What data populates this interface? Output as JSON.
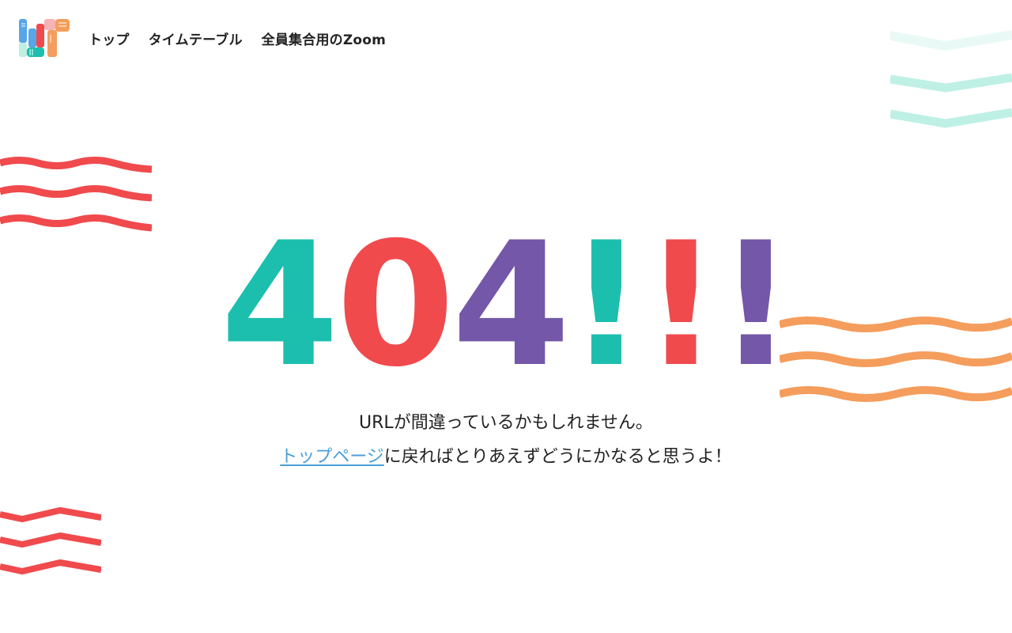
{
  "nav": {
    "items": [
      {
        "label": "トップ"
      },
      {
        "label": "タイムテーブル"
      },
      {
        "label": "全員集合用のZoom"
      }
    ]
  },
  "hero": {
    "chars": [
      {
        "text": "4",
        "color": "#1cbfad"
      },
      {
        "text": "0",
        "color": "#f04a4d"
      },
      {
        "text": "4",
        "color": "#7457a8"
      },
      {
        "text": "!",
        "color": "#1cbfad"
      },
      {
        "text": "!",
        "color": "#f04a4d"
      },
      {
        "text": "!",
        "color": "#7457a8"
      }
    ]
  },
  "message": {
    "line1": "URLが間違っているかもしれません。",
    "link_label": "トップページ",
    "line2_rest": "に戻ればとりあえずどうにかなると思うよ！"
  },
  "colors": {
    "teal": "#1cbfad",
    "red": "#f04a4d",
    "purple": "#7457a8",
    "orange": "#f59d5c",
    "mint": "#bff0e6",
    "link": "#4a9ed8"
  }
}
